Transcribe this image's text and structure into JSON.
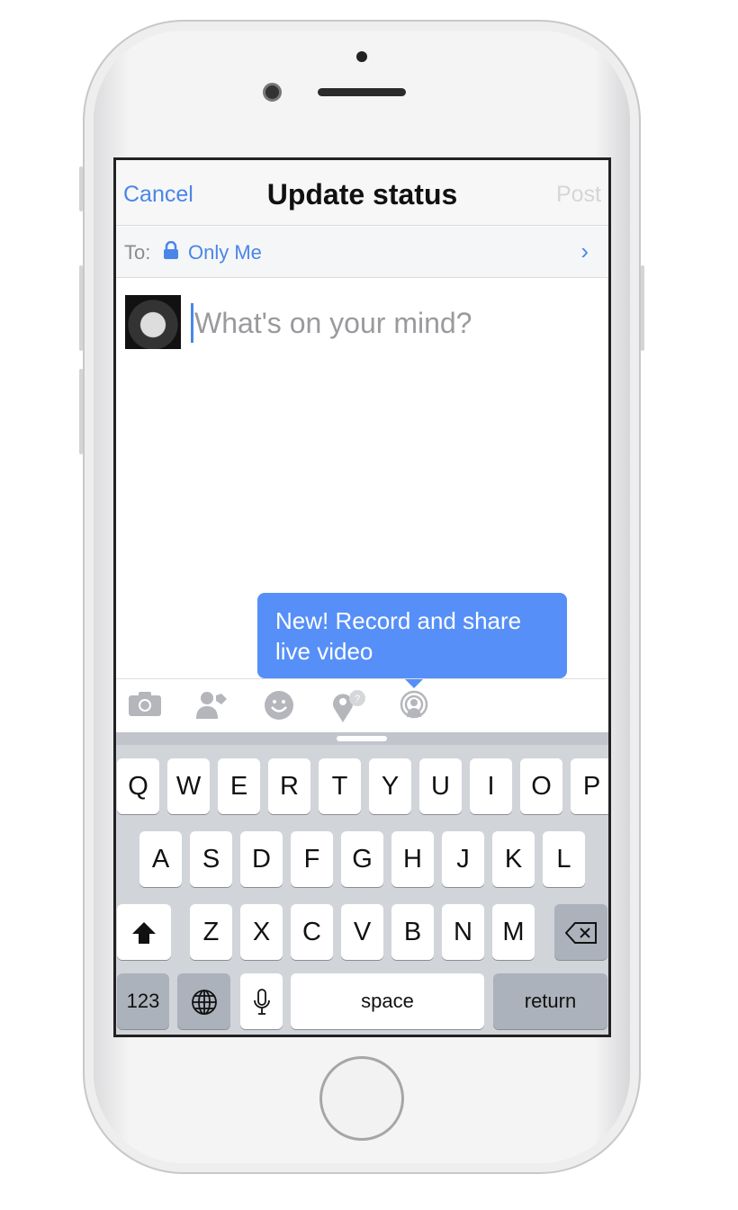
{
  "nav": {
    "cancel": "Cancel",
    "title": "Update status",
    "post": "Post"
  },
  "audience": {
    "label": "To:",
    "value": "Only Me",
    "icon": "lock-icon"
  },
  "composer": {
    "placeholder": "What's on your mind?"
  },
  "tooltip": {
    "text": "New! Record and share live video"
  },
  "toolbar": {
    "icons": [
      "camera-icon",
      "tag-people-icon",
      "emoji-icon",
      "check-in-icon",
      "live-video-icon"
    ]
  },
  "keyboard": {
    "row1": [
      "Q",
      "W",
      "E",
      "R",
      "T",
      "Y",
      "U",
      "I",
      "O",
      "P"
    ],
    "row2": [
      "A",
      "S",
      "D",
      "F",
      "G",
      "H",
      "J",
      "K",
      "L"
    ],
    "row3": [
      "Z",
      "X",
      "C",
      "V",
      "B",
      "N",
      "M"
    ],
    "numbers": "123",
    "space": "space",
    "return": "return"
  },
  "colors": {
    "accent": "#4a86e8",
    "tooltip": "#568ff8"
  }
}
